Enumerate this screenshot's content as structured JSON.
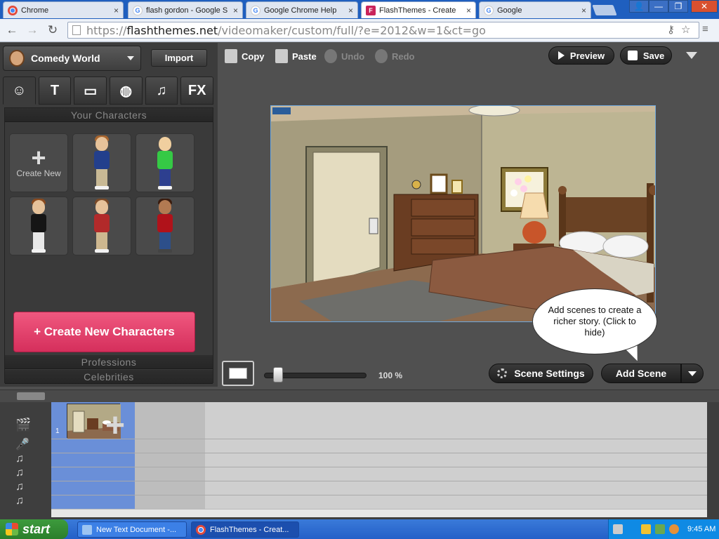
{
  "browser": {
    "tabs": [
      {
        "title": "Chrome",
        "icon": "chrome-icon",
        "close": "×"
      },
      {
        "title": "flash gordon - Google S",
        "icon": "google-icon",
        "close": "×"
      },
      {
        "title": "Google Chrome Help",
        "icon": "google-icon",
        "close": "×"
      },
      {
        "title": "FlashThemes - Create",
        "icon": "flashthemes-icon",
        "close": "×"
      },
      {
        "title": "Google",
        "icon": "google-icon",
        "close": "×"
      }
    ],
    "window_buttons": [
      "👤",
      "—",
      "❐",
      "✕"
    ],
    "url_scheme": "https://",
    "url_host": "flashthemes.net",
    "url_path": "/videomaker/custom/full/?e=2012&w=1&ct=go"
  },
  "editor": {
    "theme_name": "Comedy World",
    "import_label": "Import",
    "category_tabs": [
      {
        "icon": "character-icon",
        "glyph": "☺"
      },
      {
        "icon": "text-bubble-icon",
        "glyph": "T"
      },
      {
        "icon": "background-icon",
        "glyph": "▭"
      },
      {
        "icon": "prop-icon",
        "glyph": "◍"
      },
      {
        "icon": "music-icon",
        "glyph": "♫"
      },
      {
        "icon": "fx-icon",
        "glyph": "FX"
      }
    ],
    "your_characters_header": "Your Characters",
    "create_new_label": "Create New",
    "create_characters_button": "+ Create New Characters",
    "professions_header": "Professions",
    "celebrities_header": "Celebrities",
    "toolbar": {
      "copy": "Copy",
      "paste": "Paste",
      "undo": "Undo",
      "redo": "Redo",
      "preview": "Preview",
      "save": "Save"
    },
    "zoom_label": "100 %",
    "zoom_level": 0.1,
    "tooltip": "Add scenes to create a richer story. (Click to hide)",
    "scene_settings": "Scene Settings",
    "add_scene": "Add Scene",
    "scene_number": "1",
    "timeline_icons": [
      "🎬",
      "🎤",
      "♫",
      "♫",
      "♫",
      "♫"
    ]
  },
  "taskbar": {
    "start_label": "start",
    "tasks": [
      {
        "label": "New Text Document -...",
        "icon": "notepad-icon"
      },
      {
        "label": "FlashThemes - Creat...",
        "icon": "chrome-icon"
      }
    ],
    "clock": "9:45 AM"
  },
  "colors": {
    "accent_pink": "#e0406b",
    "chrome_blue": "#1f5fbf",
    "timeline_scene": "#6a8fd8"
  }
}
